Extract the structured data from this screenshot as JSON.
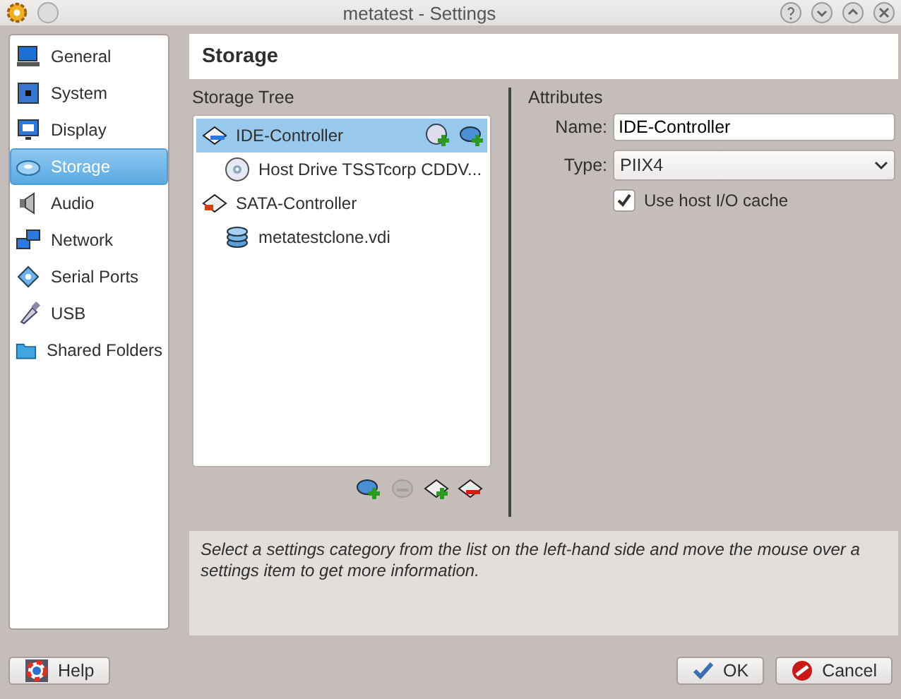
{
  "window": {
    "title": "metatest - Settings"
  },
  "sidebar": {
    "items": [
      {
        "label": "General",
        "selected": false
      },
      {
        "label": "System",
        "selected": false
      },
      {
        "label": "Display",
        "selected": false
      },
      {
        "label": "Storage",
        "selected": true
      },
      {
        "label": "Audio",
        "selected": false
      },
      {
        "label": "Network",
        "selected": false
      },
      {
        "label": "Serial Ports",
        "selected": false
      },
      {
        "label": "USB",
        "selected": false
      },
      {
        "label": "Shared Folders",
        "selected": false
      }
    ]
  },
  "page": {
    "title": "Storage"
  },
  "storage_tree": {
    "title": "Storage Tree",
    "controllers": [
      {
        "label": "IDE-Controller",
        "kind": "ide",
        "selected": true,
        "children": [
          {
            "label": "Host Drive TSSTcorp CDDV...",
            "kind": "optical",
            "selected": false
          }
        ]
      },
      {
        "label": "SATA-Controller",
        "kind": "sata",
        "selected": false,
        "children": [
          {
            "label": "metatestclone.vdi",
            "kind": "disk",
            "selected": false
          }
        ]
      }
    ],
    "toolbar": [
      {
        "kind": "add-attachment",
        "disabled": false
      },
      {
        "kind": "remove-attachment",
        "disabled": true
      },
      {
        "kind": "add-controller",
        "disabled": false
      },
      {
        "kind": "remove-controller",
        "disabled": false
      }
    ]
  },
  "attributes": {
    "title": "Attributes",
    "name_label": "Name:",
    "name_value": "IDE-Controller",
    "type_label": "Type:",
    "type_value": "PIIX4",
    "cache": {
      "label": "Use host I/O cache",
      "checked": true
    }
  },
  "info": {
    "text": "Select a settings category from the list on the left-hand side and move the mouse over a settings item to get more information."
  },
  "buttons": {
    "help": "Help",
    "ok": "OK",
    "cancel": "Cancel"
  }
}
